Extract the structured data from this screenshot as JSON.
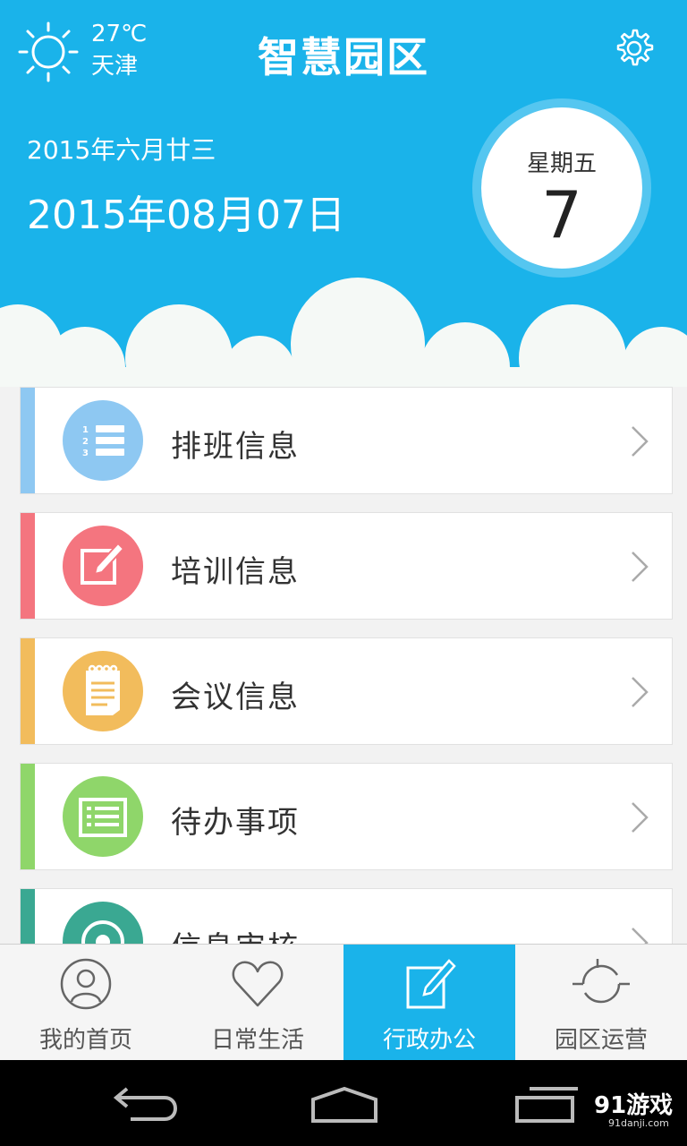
{
  "header": {
    "temperature": "27℃",
    "city": "天津",
    "title": "智慧园区",
    "weather_icon": "sun-icon",
    "settings_icon": "gear-icon"
  },
  "date_banner": {
    "lunar_date": "2015年六月廿三",
    "gregorian_date": "2015年08月07日",
    "weekday": "星期五",
    "day": "7"
  },
  "menu": {
    "items": [
      {
        "label": "排班信息",
        "icon": "numbered-list-icon",
        "color": "#8ec8f2",
        "bar_color": "#8ec8f2"
      },
      {
        "label": "培训信息",
        "icon": "edit-pencil-icon",
        "color": "#f4757f",
        "bar_color": "#f4757f"
      },
      {
        "label": "会议信息",
        "icon": "notepad-icon",
        "color": "#f2bc5c",
        "bar_color": "#f2bc5c"
      },
      {
        "label": "待办事项",
        "icon": "todo-list-icon",
        "color": "#8fd66a",
        "bar_color": "#8fd66a"
      },
      {
        "label": "信息审核",
        "icon": "review-icon",
        "color": "#3aa892",
        "bar_color": "#3aa892"
      }
    ]
  },
  "tabs": [
    {
      "label": "我的首页",
      "icon": "user-avatar-icon",
      "active": false
    },
    {
      "label": "日常生活",
      "icon": "heart-icon",
      "active": false
    },
    {
      "label": "行政办公",
      "icon": "edit-box-icon",
      "active": true
    },
    {
      "label": "园区运营",
      "icon": "cycle-icon",
      "active": false
    }
  ],
  "watermark": {
    "brand": "91游戏",
    "site": "91danji.com"
  },
  "colors": {
    "primary": "#1ab3ea"
  }
}
